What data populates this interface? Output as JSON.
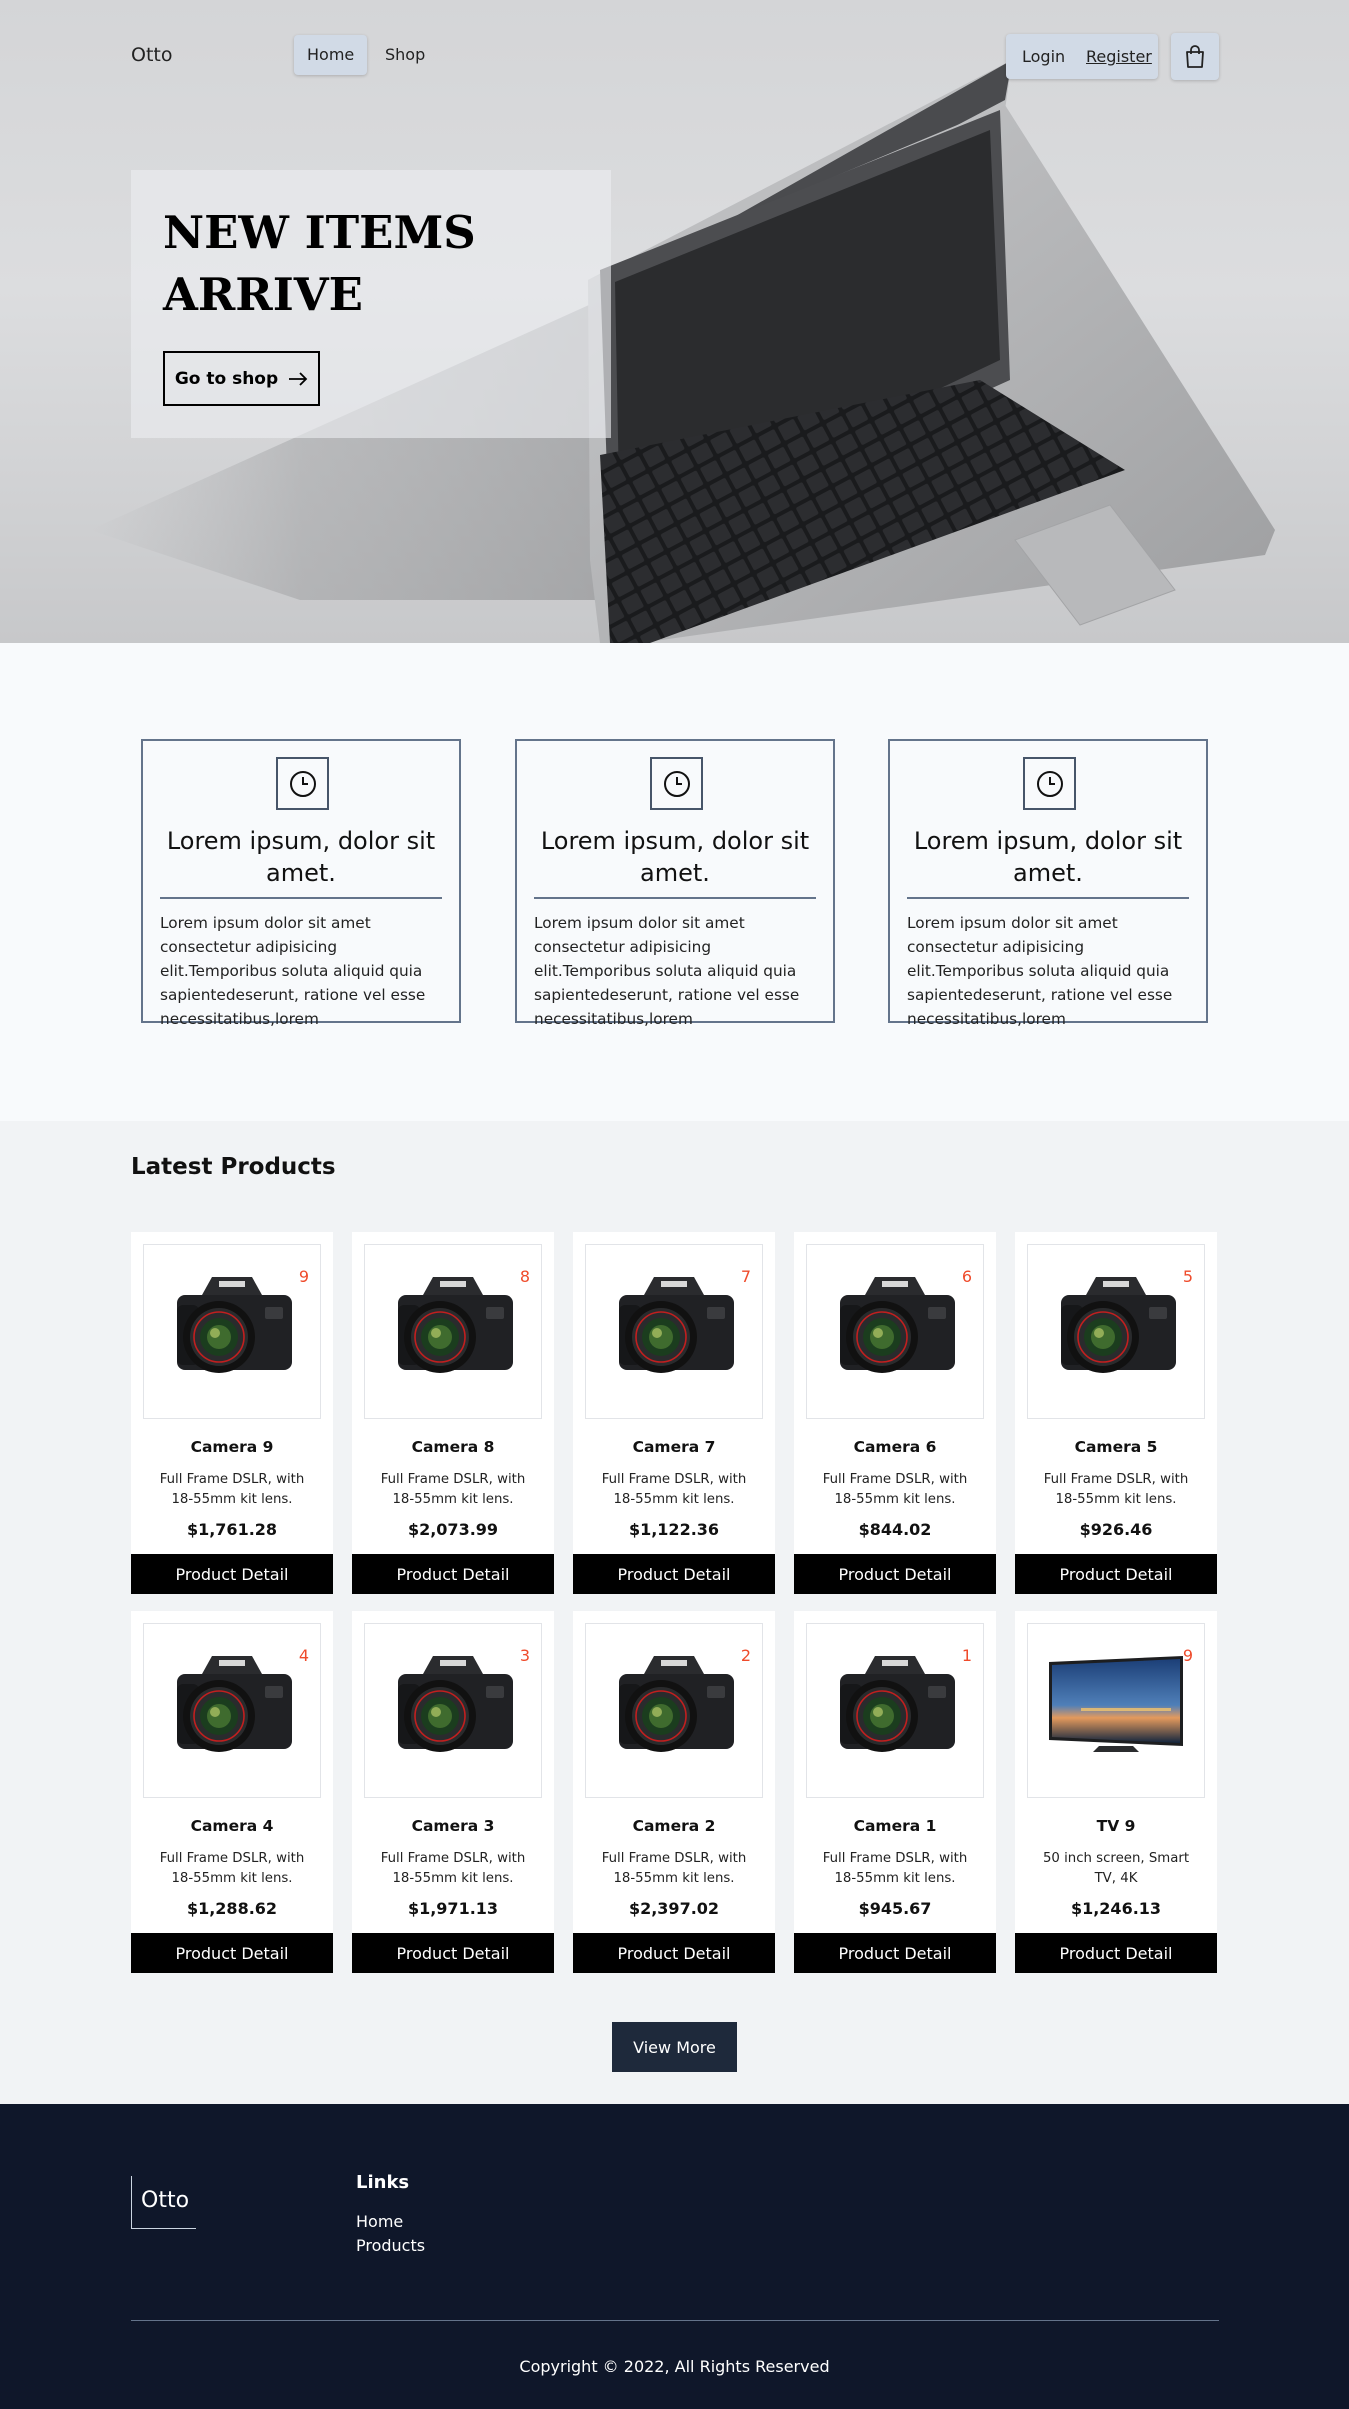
{
  "nav": {
    "brand": "Otto",
    "links": [
      "Home",
      "Shop"
    ],
    "login": "Login",
    "register": "Register",
    "cart_icon": "shopping-bag-icon"
  },
  "hero": {
    "title": "NEW ITEMS ARRIVE",
    "cta": "Go to shop",
    "cta_icon": "arrow-right-icon"
  },
  "features": [
    {
      "icon": "clock-icon",
      "title": "Lorem ipsum, dolor sit amet.",
      "text": "Lorem ipsum dolor sit amet consectetur adipisicing elit.Temporibus soluta aliquid quia sapientedeserunt, ratione vel esse necessitatibus,lorem"
    },
    {
      "icon": "clock-icon",
      "title": "Lorem ipsum, dolor sit amet.",
      "text": "Lorem ipsum dolor sit amet consectetur adipisicing elit.Temporibus soluta aliquid quia sapientedeserunt, ratione vel esse necessitatibus,lorem"
    },
    {
      "icon": "clock-icon",
      "title": "Lorem ipsum, dolor sit amet.",
      "text": "Lorem ipsum dolor sit amet consectetur adipisicing elit.Temporibus soluta aliquid quia sapientedeserunt, ratione vel esse necessitatibus,lorem"
    }
  ],
  "products": {
    "title": "Latest Products",
    "button_label": "Product Detail",
    "items": [
      {
        "badge": "9",
        "name": "Camera 9",
        "desc": "Full Frame DSLR, with 18-55mm kit lens.",
        "price": "$1,761.28"
      },
      {
        "badge": "8",
        "name": "Camera 8",
        "desc": "Full Frame DSLR, with 18-55mm kit lens.",
        "price": "$2,073.99"
      },
      {
        "badge": "7",
        "name": "Camera 7",
        "desc": "Full Frame DSLR, with 18-55mm kit lens.",
        "price": "$1,122.36"
      },
      {
        "badge": "6",
        "name": "Camera 6",
        "desc": "Full Frame DSLR, with 18-55mm kit lens.",
        "price": "$844.02"
      },
      {
        "badge": "5",
        "name": "Camera 5",
        "desc": "Full Frame DSLR, with 18-55mm kit lens.",
        "price": "$926.46"
      },
      {
        "badge": "4",
        "name": "Camera 4",
        "desc": "Full Frame DSLR, with 18-55mm kit lens.",
        "price": "$1,288.62"
      },
      {
        "badge": "3",
        "name": "Camera 3",
        "desc": "Full Frame DSLR, with 18-55mm kit lens.",
        "price": "$1,971.13"
      },
      {
        "badge": "2",
        "name": "Camera 2",
        "desc": "Full Frame DSLR, with 18-55mm kit lens.",
        "price": "$2,397.02"
      },
      {
        "badge": "1",
        "name": "Camera 1",
        "desc": "Full Frame DSLR, with 18-55mm kit lens.",
        "price": "$945.67"
      },
      {
        "badge": "9",
        "name": "TV 9",
        "desc": "50 inch screen, Smart TV, 4K",
        "price": "$1,246.13"
      }
    ],
    "view_more": "View More"
  },
  "footer": {
    "brand": "Otto",
    "links_heading": "Links",
    "links": [
      "Home",
      "Products"
    ],
    "copyright": "Copyright © 2022, All Rights Reserved"
  }
}
